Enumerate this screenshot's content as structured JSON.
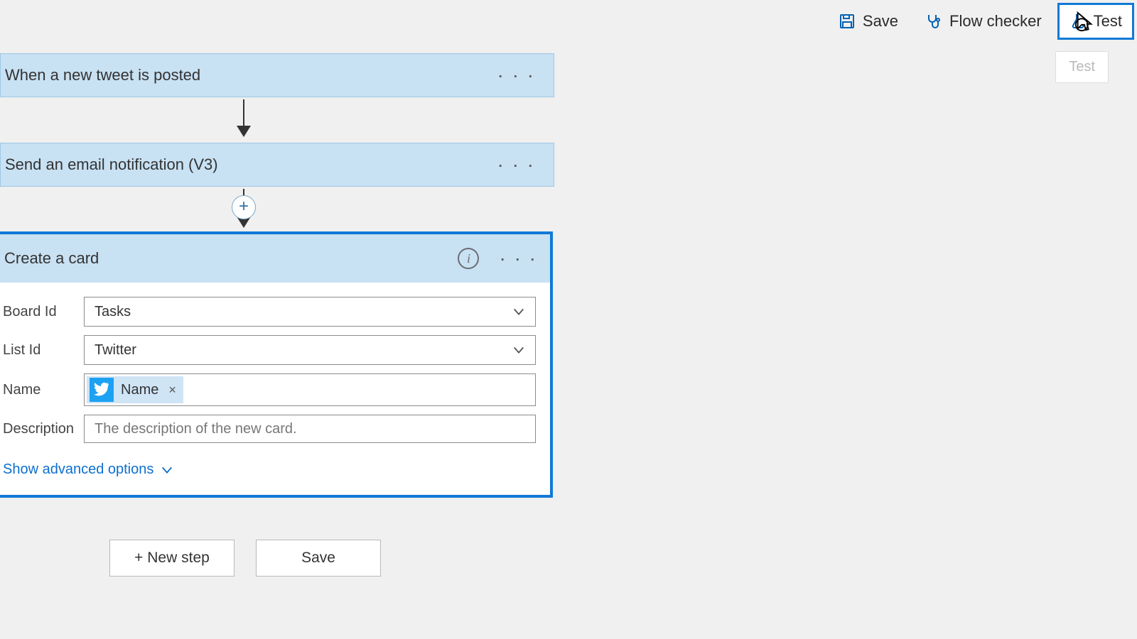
{
  "toolbar": {
    "save": "Save",
    "checker": "Flow checker",
    "test": "Test",
    "test_tooltip": "Test"
  },
  "flow": {
    "trigger": {
      "title": "When a new tweet is posted"
    },
    "action1": {
      "title": "Send an email notification (V3)"
    },
    "card": {
      "title": "Create a card",
      "fields": {
        "board_id": {
          "label": "Board Id",
          "value": "Tasks"
        },
        "list_id": {
          "label": "List Id",
          "value": "Twitter"
        },
        "name": {
          "label": "Name",
          "chip": "Name"
        },
        "desc": {
          "label": "Description",
          "placeholder": "The description of the new card."
        }
      },
      "advanced": "Show advanced options"
    }
  },
  "buttons": {
    "new_step": "+ New step",
    "save": "Save"
  }
}
